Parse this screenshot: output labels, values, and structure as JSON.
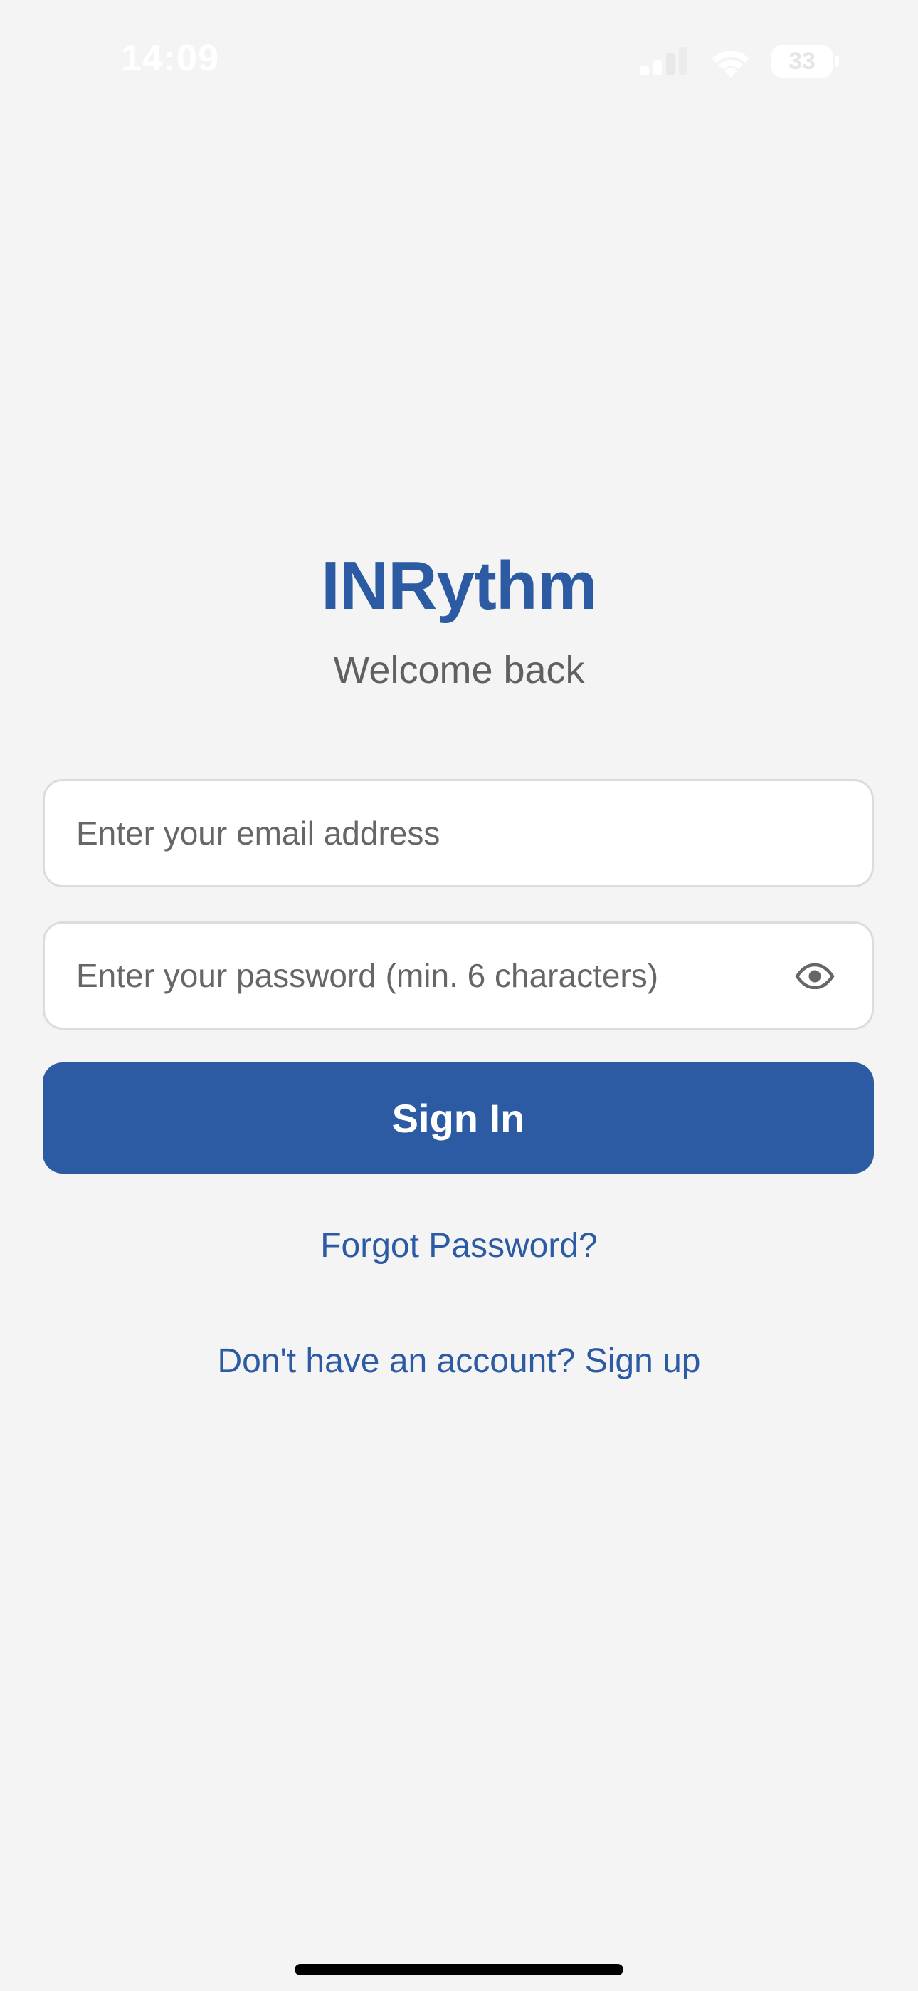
{
  "status_bar": {
    "time": "14:09",
    "battery_level": "33",
    "icons": [
      "cellular-signal-icon",
      "wifi-icon",
      "battery-icon"
    ]
  },
  "app": {
    "title": "INRythm",
    "subtitle": "Welcome back"
  },
  "form": {
    "email": {
      "value": "",
      "placeholder": "Enter your email address"
    },
    "password": {
      "value": "",
      "placeholder": "Enter your password (min. 6 characters)",
      "toggle_icon": "eye-icon"
    },
    "submit_label": "Sign In"
  },
  "links": {
    "forgot_password": "Forgot Password?",
    "sign_up": "Don't have an account? Sign up"
  },
  "colors": {
    "brand": "#2c5ba3",
    "background": "#f4f4f4",
    "subtitle_text": "#606060",
    "input_border": "#dcdcdc"
  }
}
